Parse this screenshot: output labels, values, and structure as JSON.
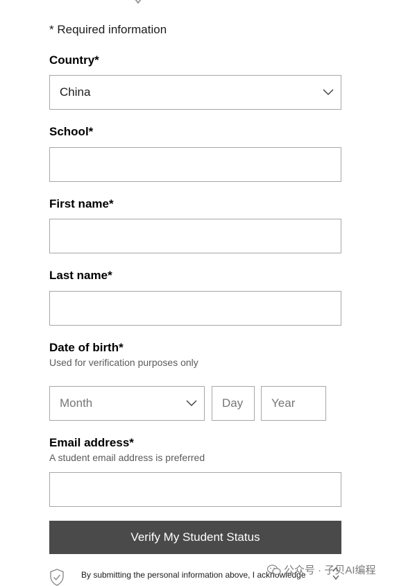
{
  "form": {
    "required_note": "* Required information",
    "country": {
      "label": "Country*",
      "value": "China"
    },
    "school": {
      "label": "School*",
      "value": ""
    },
    "first_name": {
      "label": "First name*",
      "value": ""
    },
    "last_name": {
      "label": "Last name*",
      "value": ""
    },
    "dob": {
      "label": "Date of birth*",
      "hint": "Used for verification purposes only",
      "month_placeholder": "Month",
      "day_placeholder": "Day",
      "year_placeholder": "Year"
    },
    "email": {
      "label": "Email address*",
      "hint": "A student email address is preferred",
      "value": ""
    },
    "submit_label": "Verify My Student Status",
    "consent_text": "By submitting the personal information above, I acknowledge"
  },
  "watermark": {
    "text": "公众号 · 子贝AI编程"
  },
  "colors": {
    "button_bg": "#4a4a4a",
    "border": "#a6a6a6",
    "hint": "#5a5a5a"
  },
  "icons": [
    "chevron-down-icon",
    "shield-check-icon",
    "wechat-icon",
    "scroll-arrow-icon"
  ]
}
